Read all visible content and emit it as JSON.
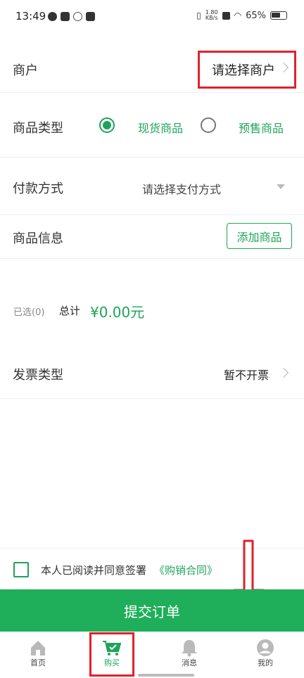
{
  "status_bar": {
    "time": "13:49",
    "net_speed": "1.80\nKB/s",
    "battery": "65%"
  },
  "merchant": {
    "label": "商户",
    "value": "请选择商户"
  },
  "product_type": {
    "label": "商品类型",
    "option_spot": "现货商品",
    "option_presale": "预售商品",
    "selected": "现货商品"
  },
  "payment": {
    "label": "付款方式",
    "placeholder": "请选择支付方式"
  },
  "product_info": {
    "label": "商品信息",
    "add_button": "添加商品"
  },
  "summary": {
    "selected": "已选(0)",
    "total_label": "总计",
    "total_value": "¥0.00元"
  },
  "invoice": {
    "label": "发票类型",
    "value": "暂不开票"
  },
  "agreement": {
    "text": "本人已阅读并同意签署",
    "link": "《购销合同》"
  },
  "submit": {
    "label": "提交订单"
  },
  "bottom_nav": {
    "items": [
      {
        "label": "首页"
      },
      {
        "label": "购买"
      },
      {
        "label": "消息"
      },
      {
        "label": "我的"
      }
    ],
    "active": "购买"
  },
  "colors": {
    "accent": "#1fa35a",
    "submit_bg": "#1fae5a",
    "highlight": "#e0222b"
  }
}
